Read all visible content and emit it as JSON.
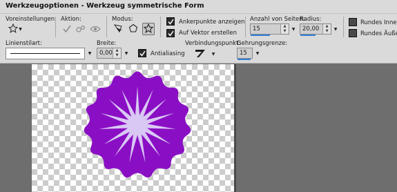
{
  "window": {
    "title": "Werkzeugoptionen - Werkzeug symmetrische Form"
  },
  "presets": {
    "label": "Voreinstellungen:"
  },
  "action": {
    "label": "Aktion:"
  },
  "mode": {
    "label": "Modus:"
  },
  "options": {
    "show_anchor_points": "Ankerpunkte anzeigen",
    "create_on_vector": "Auf Vektor erstellen",
    "round_inner": "Rundes Inneres",
    "round_outer": "Rundes Äußeres"
  },
  "sides": {
    "label": "Anzahl von Seiten:",
    "value": "15"
  },
  "radius": {
    "label": "Radius:",
    "value": "20,00"
  },
  "line_style": {
    "label": "Linienstilart:"
  },
  "width": {
    "label": "Breite:",
    "value": "0,00"
  },
  "antialias": {
    "label": "Antialiasing"
  },
  "join": {
    "label": "Verbindungspunkt:"
  },
  "miter": {
    "label": "Gehrungsgrenze:",
    "value": "15"
  },
  "colors": {
    "fill": "#8a0fc4",
    "rays": "#d9c8f4",
    "accent": "#2f7fd8"
  }
}
